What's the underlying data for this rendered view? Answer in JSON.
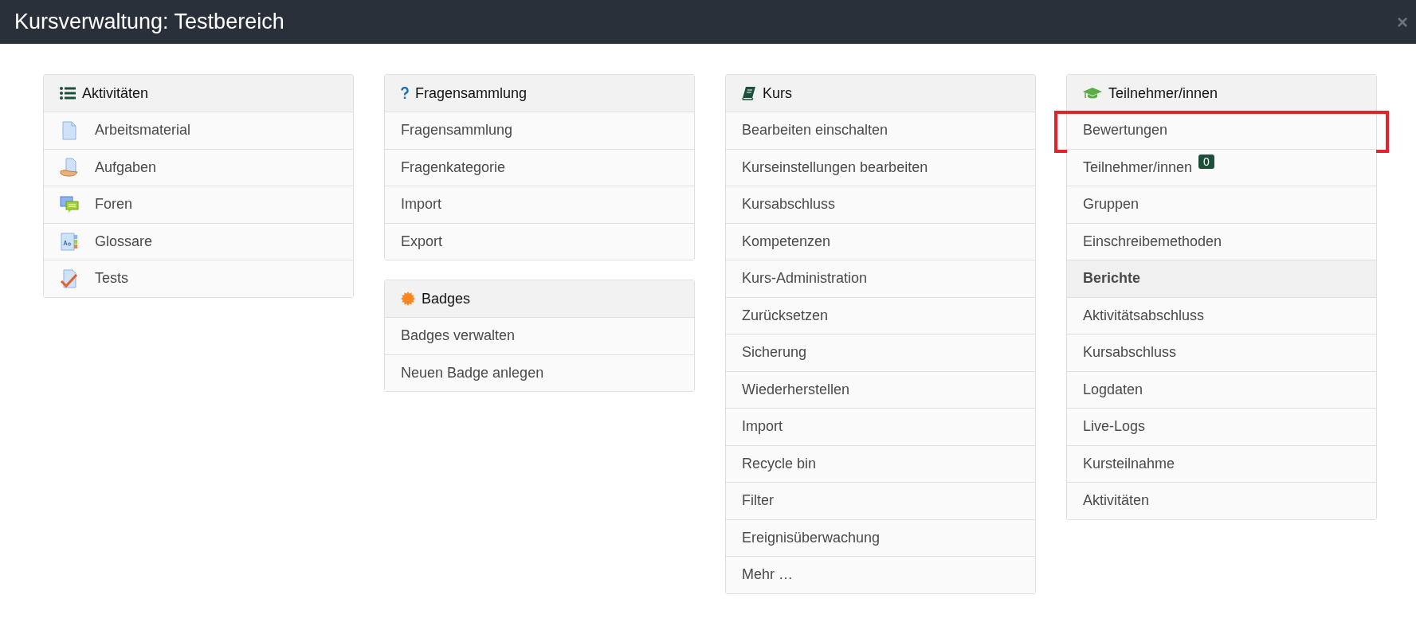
{
  "window": {
    "title": "Kursverwaltung: Testbereich",
    "close": "×"
  },
  "columns": [
    {
      "panels": [
        {
          "title": "Aktivitäten",
          "items": [
            {
              "label": "Arbeitsmaterial",
              "kind": "link",
              "highlighted": false
            },
            {
              "label": "Aufgaben",
              "kind": "link",
              "highlighted": false
            },
            {
              "label": "Foren",
              "kind": "link",
              "highlighted": false
            },
            {
              "label": "Glossare",
              "kind": "link",
              "highlighted": false
            },
            {
              "label": "Tests",
              "kind": "link",
              "highlighted": false
            }
          ]
        }
      ]
    },
    {
      "panels": [
        {
          "title": "Fragensammlung",
          "items": [
            {
              "label": "Fragensammlung",
              "kind": "link",
              "highlighted": false
            },
            {
              "label": "Fragenkategorie",
              "kind": "link",
              "highlighted": false
            },
            {
              "label": "Import",
              "kind": "link",
              "highlighted": false
            },
            {
              "label": "Export",
              "kind": "link",
              "highlighted": false
            }
          ]
        },
        {
          "title": "Badges",
          "items": [
            {
              "label": "Badges verwalten",
              "kind": "link",
              "highlighted": false
            },
            {
              "label": "Neuen Badge anlegen",
              "kind": "link",
              "highlighted": false
            }
          ]
        }
      ]
    },
    {
      "panels": [
        {
          "title": "Kurs",
          "items": [
            {
              "label": "Bearbeiten einschalten",
              "kind": "link",
              "highlighted": false
            },
            {
              "label": "Kurseinstellungen bearbeiten",
              "kind": "link",
              "highlighted": false
            },
            {
              "label": "Kursabschluss",
              "kind": "link",
              "highlighted": false
            },
            {
              "label": "Kompetenzen",
              "kind": "link",
              "highlighted": false
            },
            {
              "label": "Kurs-Administration",
              "kind": "link",
              "highlighted": false
            },
            {
              "label": "Zurücksetzen",
              "kind": "link",
              "highlighted": false
            },
            {
              "label": "Sicherung",
              "kind": "link",
              "highlighted": false
            },
            {
              "label": "Wiederherstellen",
              "kind": "link",
              "highlighted": false
            },
            {
              "label": "Import",
              "kind": "link",
              "highlighted": false
            },
            {
              "label": "Recycle bin",
              "kind": "link",
              "highlighted": false
            },
            {
              "label": "Filter",
              "kind": "link",
              "highlighted": false
            },
            {
              "label": "Ereignisüberwachung",
              "kind": "link",
              "highlighted": false
            },
            {
              "label": "Mehr …",
              "kind": "link",
              "highlighted": false
            }
          ]
        }
      ]
    },
    {
      "panels": [
        {
          "title": "Teilnehmer/innen",
          "items": [
            {
              "label": "Bewertungen",
              "kind": "link",
              "highlighted": true
            },
            {
              "label": "Teilnehmer/innen",
              "kind": "link",
              "highlighted": false,
              "badge": "0"
            },
            {
              "label": "Gruppen",
              "kind": "link",
              "highlighted": false
            },
            {
              "label": "Einschreibemethoden",
              "kind": "link",
              "highlighted": false
            },
            {
              "label": "Berichte",
              "kind": "heading",
              "highlighted": false
            },
            {
              "label": "Aktivitätsabschluss",
              "kind": "link",
              "highlighted": false
            },
            {
              "label": "Kursabschluss",
              "kind": "link",
              "highlighted": false
            },
            {
              "label": "Logdaten",
              "kind": "link",
              "highlighted": false
            },
            {
              "label": "Live-Logs",
              "kind": "link",
              "highlighted": false
            },
            {
              "label": "Kursteilnahme",
              "kind": "link",
              "highlighted": false
            },
            {
              "label": "Aktivitäten",
              "kind": "link",
              "highlighted": false
            }
          ]
        }
      ]
    }
  ]
}
